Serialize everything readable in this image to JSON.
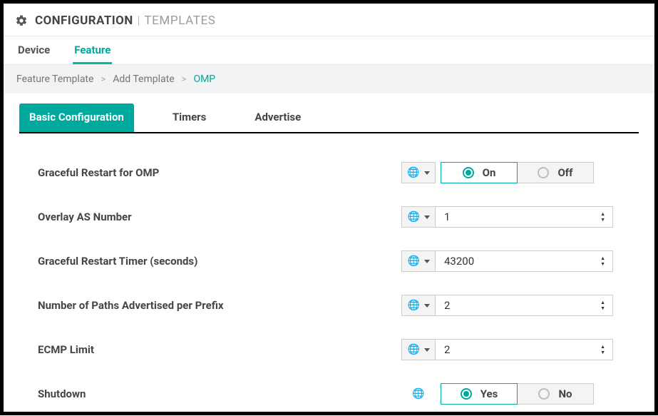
{
  "header": {
    "title_main": "CONFIGURATION",
    "title_sep": "|",
    "title_sub": "TEMPLATES"
  },
  "top_tabs": [
    {
      "label": "Device",
      "active": false
    },
    {
      "label": "Feature",
      "active": true
    }
  ],
  "breadcrumb": [
    {
      "label": "Feature Template"
    },
    {
      "label": "Add Template"
    },
    {
      "label": "OMP",
      "current": true
    }
  ],
  "section_tabs": [
    {
      "label": "Basic Configuration",
      "active": true
    },
    {
      "label": "Timers"
    },
    {
      "label": "Advertise"
    }
  ],
  "form": {
    "graceful_restart": {
      "label": "Graceful Restart for OMP",
      "options": {
        "on": "On",
        "off": "Off"
      },
      "value": "On"
    },
    "overlay_as": {
      "label": "Overlay AS Number",
      "value": "1"
    },
    "gr_timer": {
      "label": "Graceful Restart Timer (seconds)",
      "value": "43200"
    },
    "paths_per_prefix": {
      "label": "Number of Paths Advertised per Prefix",
      "value": "2"
    },
    "ecmp_limit": {
      "label": "ECMP Limit",
      "value": "2"
    },
    "shutdown": {
      "label": "Shutdown",
      "options": {
        "yes": "Yes",
        "no": "No"
      },
      "value": "Yes"
    }
  },
  "icons": {
    "scope": "global"
  },
  "colors": {
    "accent": "#00a99d",
    "globe": "#41b883"
  }
}
